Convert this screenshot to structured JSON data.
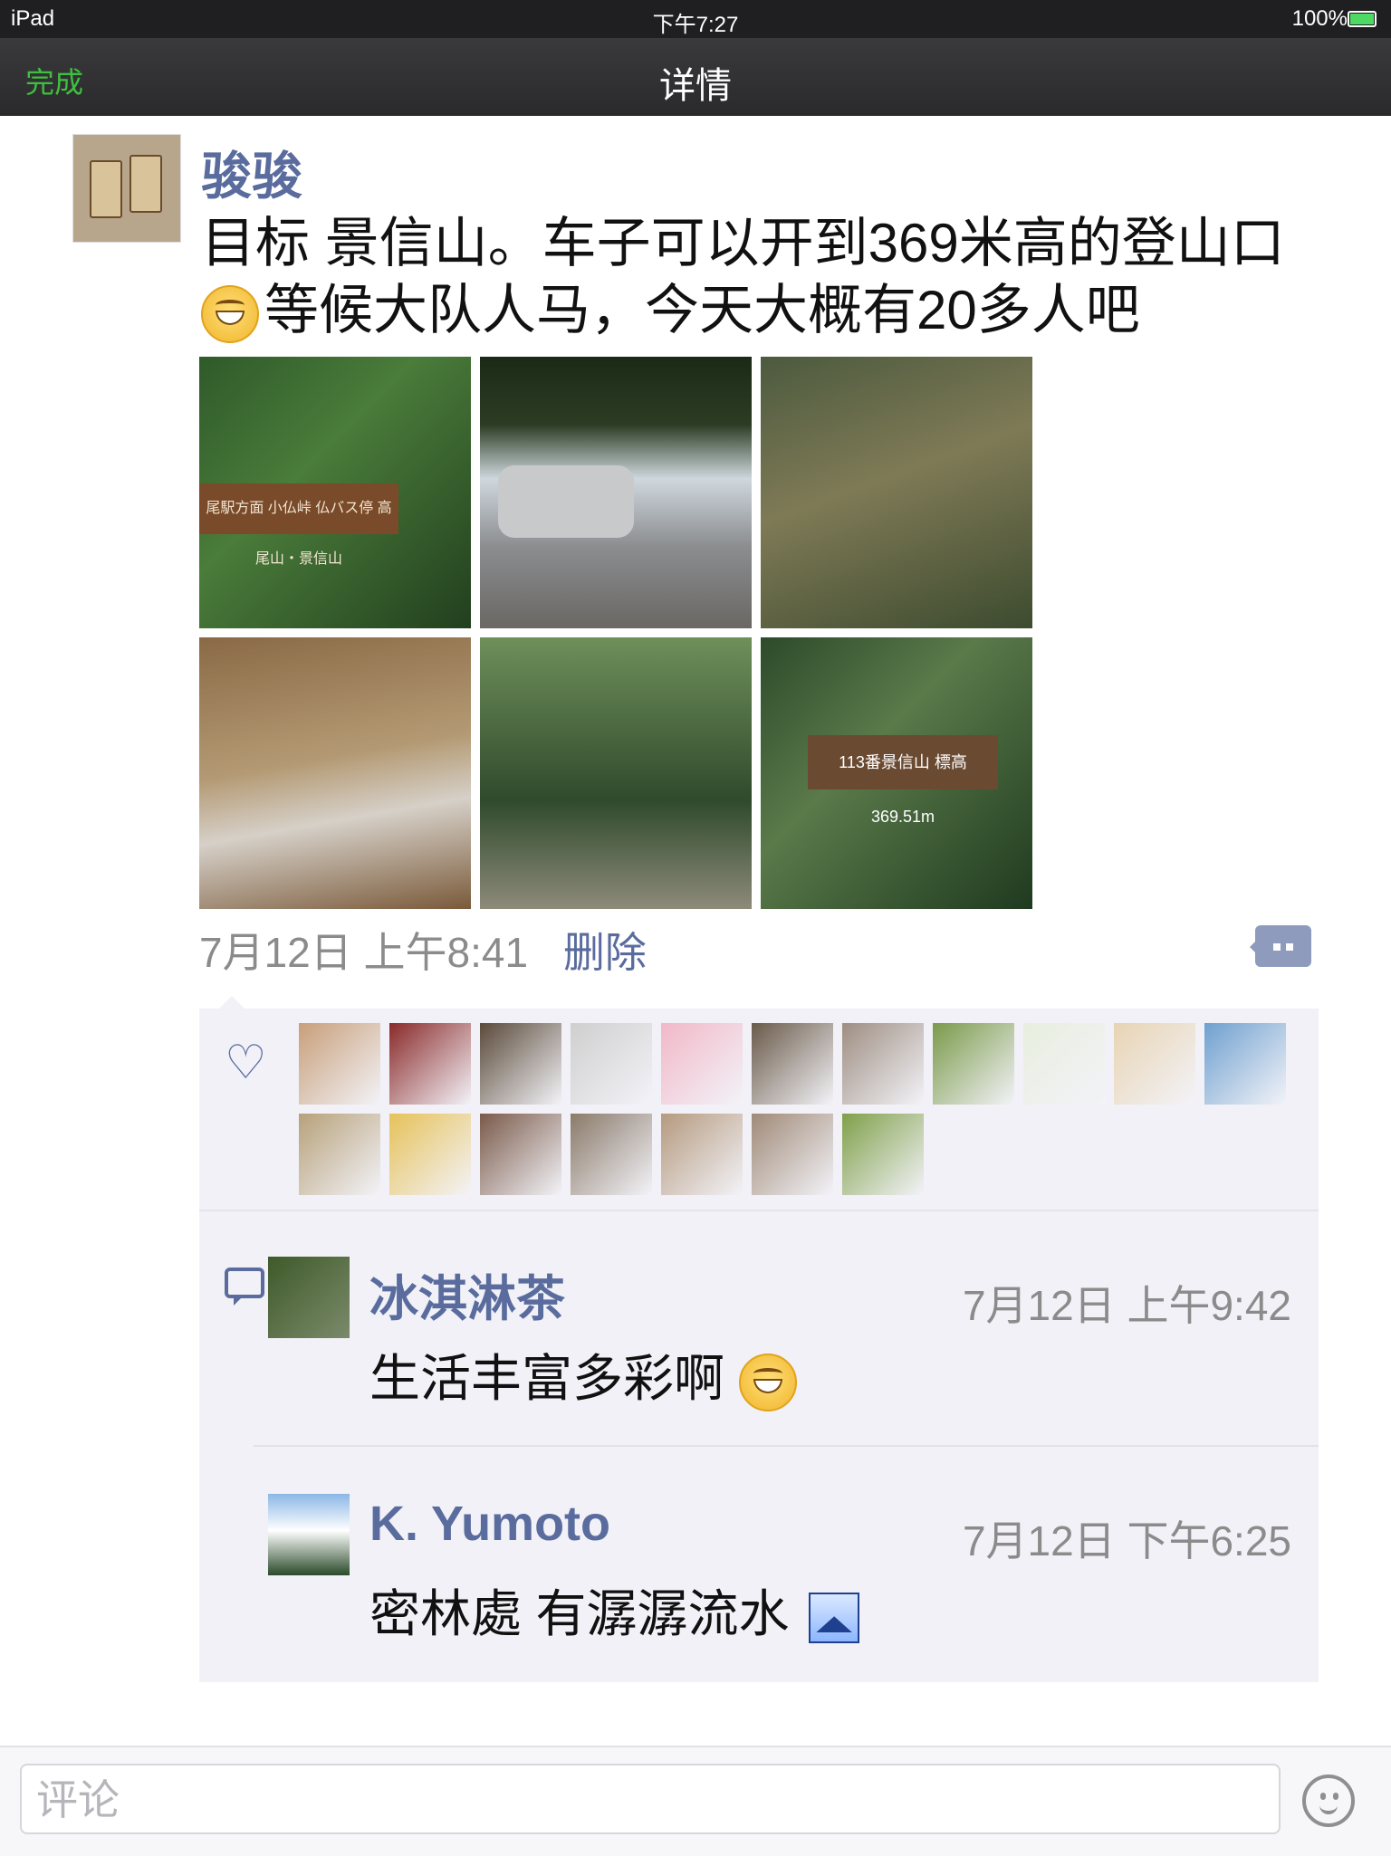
{
  "status": {
    "device": "iPad",
    "time": "下午7:27",
    "battery": "100%"
  },
  "nav": {
    "done": "完成",
    "title": "详情"
  },
  "post": {
    "author": "骏骏",
    "text_line1": "目标 景信山。车子可以开到369米高的登山口",
    "text_line2": "等候大队人马，今天大概有20多人吧",
    "photo1_sign": "尾駅方面 小仏峠 仏バス停 高尾山・景信山",
    "photo6_sign": "113番景信山 標高369.51m",
    "meta_time": "7月12日 上午8:41",
    "delete_label": "删除"
  },
  "likes": {
    "count": 19,
    "avatar_colors": [
      "#c89f7a",
      "#8a2a2a",
      "#5a4a3a",
      "#cfcfcf",
      "#f1b8c8",
      "#6a5a4a",
      "#9e8e82",
      "#7a9a4a",
      "#e8eedf",
      "#e8d4b4",
      "#6fa0cf",
      "#b7a17a",
      "#e6c25a",
      "#7a5a4a",
      "#8a7a6a",
      "#b59a7f",
      "#a08a78",
      "#7fa04a"
    ]
  },
  "comments": [
    {
      "name": "冰淇淋茶",
      "time": "7月12日 上午9:42",
      "text": "生活丰富多彩啊"
    },
    {
      "name": "K. Yumoto",
      "time": "7月12日 下午6:25",
      "text": "密林處 有潺潺流水"
    }
  ],
  "input": {
    "placeholder": "评论"
  }
}
